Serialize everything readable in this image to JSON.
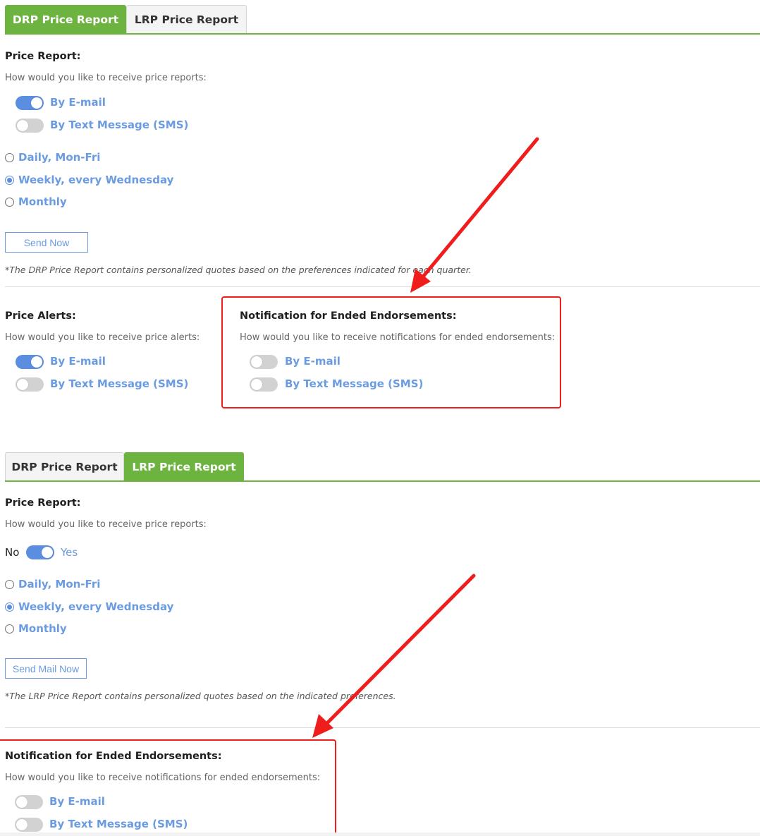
{
  "top_panel": {
    "tabs": [
      {
        "label": "DRP Price Report",
        "active": true
      },
      {
        "label": "LRP Price Report",
        "active": false
      }
    ],
    "price_report": {
      "title": "Price Report:",
      "subtitle": "How would you like to receive price reports:",
      "toggles": [
        {
          "label": "By E-mail",
          "on": true
        },
        {
          "label": "By Text Message (SMS)",
          "on": false
        }
      ],
      "frequency": [
        {
          "label": "Daily, Mon-Fri",
          "checked": false
        },
        {
          "label": "Weekly, every Wednesday",
          "checked": true
        },
        {
          "label": "Monthly",
          "checked": false
        }
      ],
      "send_button": "Send Now",
      "note": "*The DRP Price Report contains personalized quotes based on the preferences indicated for each quarter."
    },
    "price_alerts": {
      "title": "Price Alerts:",
      "subtitle": "How would you like to receive price alerts:",
      "toggles": [
        {
          "label": "By E-mail",
          "on": true
        },
        {
          "label": "By Text Message (SMS)",
          "on": false
        }
      ]
    },
    "ended_endorsements": {
      "title": "Notification for Ended Endorsements:",
      "subtitle": "How would you like to receive notifications for ended endorsements:",
      "toggles": [
        {
          "label": "By E-mail",
          "on": false
        },
        {
          "label": "By Text Message (SMS)",
          "on": false
        }
      ]
    }
  },
  "bottom_panel": {
    "tabs": [
      {
        "label": "DRP Price Report",
        "active": false
      },
      {
        "label": "LRP Price Report",
        "active": true
      }
    ],
    "price_report": {
      "title": "Price Report:",
      "subtitle": "How would you like to receive price reports:",
      "toggle_no_label": "No",
      "toggle_yes_label": "Yes",
      "toggle_on": true,
      "frequency": [
        {
          "label": "Daily, Mon-Fri",
          "checked": false
        },
        {
          "label": "Weekly, every Wednesday",
          "checked": true
        },
        {
          "label": "Monthly",
          "checked": false
        }
      ],
      "send_button": "Send Mail Now",
      "note": "*The LRP Price Report contains personalized quotes based on the indicated preferences."
    },
    "ended_endorsements": {
      "title": "Notification for Ended Endorsements:",
      "subtitle": "How would you like to receive notifications for ended endorsements:",
      "toggles": [
        {
          "label": "By E-mail",
          "on": false
        },
        {
          "label": "By Text Message (SMS)",
          "on": false
        }
      ]
    }
  },
  "colors": {
    "tab_active": "#6db33f",
    "link_blue": "#6b9be0",
    "switch_on": "#5b8ee0",
    "switch_off": "#d2d2d2",
    "annotation_red": "#f01d1d"
  }
}
